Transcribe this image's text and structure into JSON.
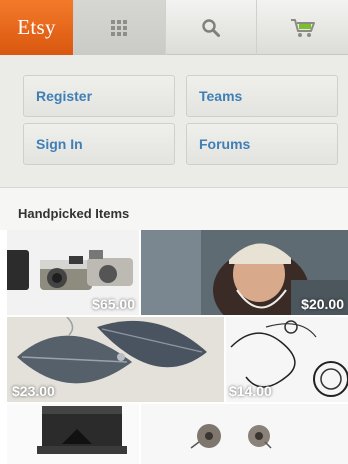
{
  "header": {
    "logo_text": "Etsy",
    "nav": [
      {
        "icon": "grid-icon"
      },
      {
        "icon": "search-icon"
      },
      {
        "icon": "cart-icon"
      }
    ]
  },
  "menu": {
    "items": [
      "Register",
      "Teams",
      "Sign In",
      "Forums"
    ]
  },
  "section": {
    "title": "Handpicked Items"
  },
  "items": [
    {
      "price": "$65.00"
    },
    {
      "price": "$20.00"
    },
    {
      "price": "$23.00"
    },
    {
      "price": "$14.00"
    },
    {
      "price": ""
    },
    {
      "price": ""
    }
  ],
  "colors": {
    "brand": "#f1641e",
    "link": "#3f7fb6",
    "cart_accent": "#7bbf2a"
  }
}
